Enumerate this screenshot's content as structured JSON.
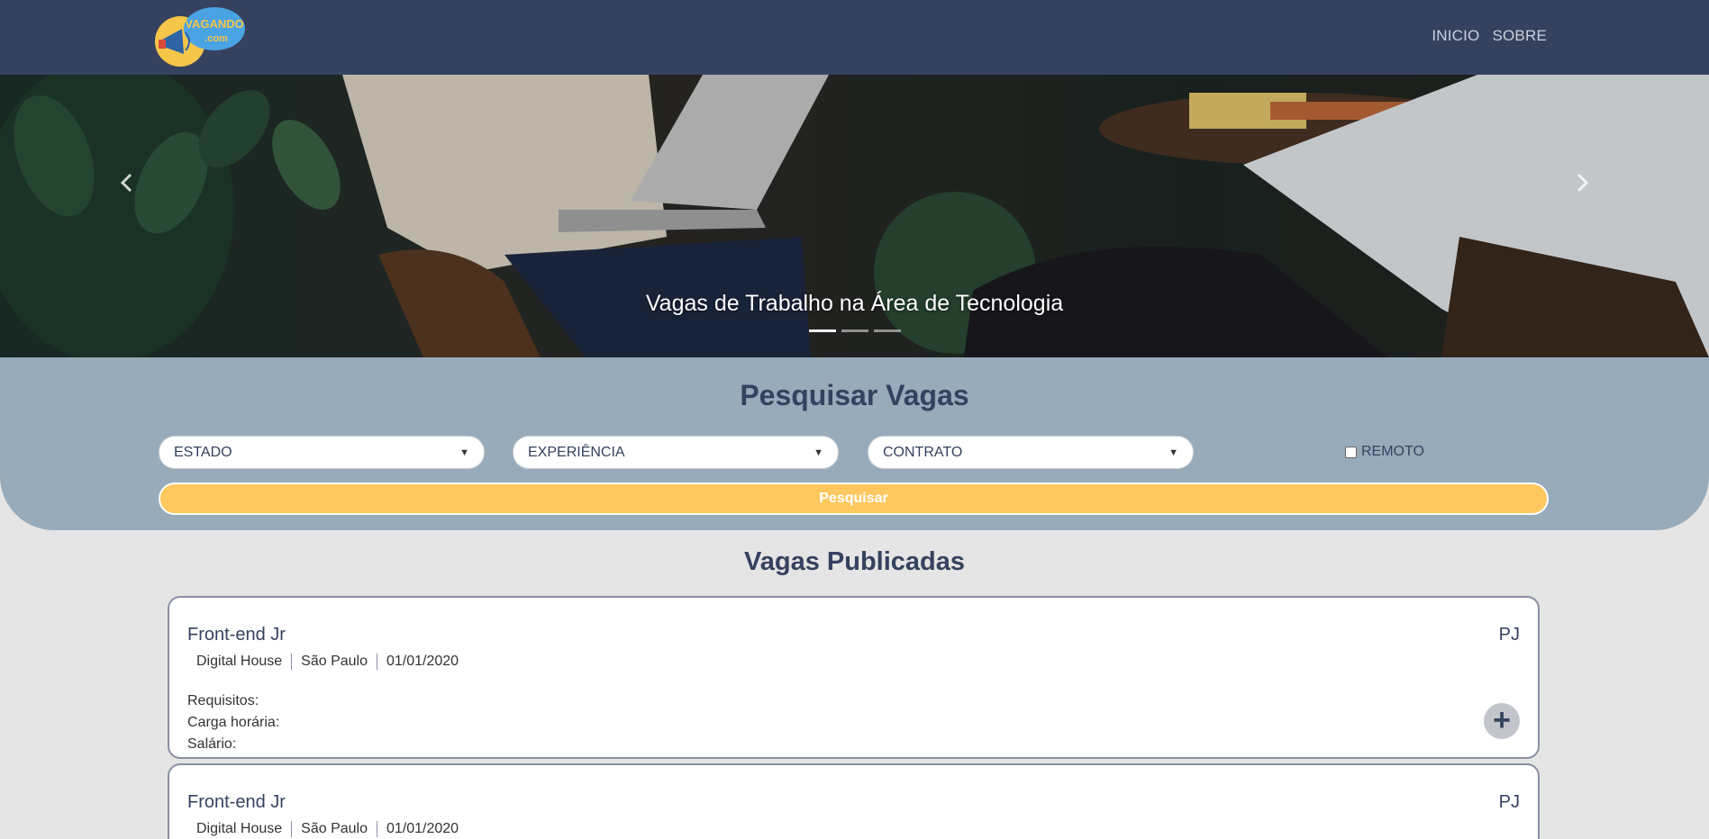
{
  "navbar": {
    "logo_text": "VAGANDO",
    "logo_sub": ".com",
    "links": [
      "INICIO",
      "SOBRE"
    ]
  },
  "hero": {
    "caption": "Vagas de Trabalho na Área de Tecnologia",
    "slides": 3,
    "active_slide": 1
  },
  "search": {
    "title": "Pesquisar Vagas",
    "selects": [
      "ESTADO",
      "EXPERIÊNCIA",
      "CONTRATO"
    ],
    "remote_label": "REMOTO",
    "button_label": "Pesquisar"
  },
  "jobs": {
    "title": "Vagas Publicadas",
    "items": [
      {
        "title": "Front-end Jr",
        "contract": "PJ",
        "company": "Digital House",
        "location": "São Paulo",
        "date": "01/01/2020",
        "requirements_label": "Requisitos:",
        "hours_label": "Carga horária:",
        "salary_label": "Salário:"
      },
      {
        "title": "Front-end Jr",
        "contract": "PJ",
        "company": "Digital House",
        "location": "São Paulo",
        "date": "01/01/2020"
      }
    ]
  },
  "colors": {
    "navbar": "#35425f",
    "search_bg": "#97abbb",
    "accent": "#ffc85f",
    "page_bg": "#e5e5e5"
  }
}
